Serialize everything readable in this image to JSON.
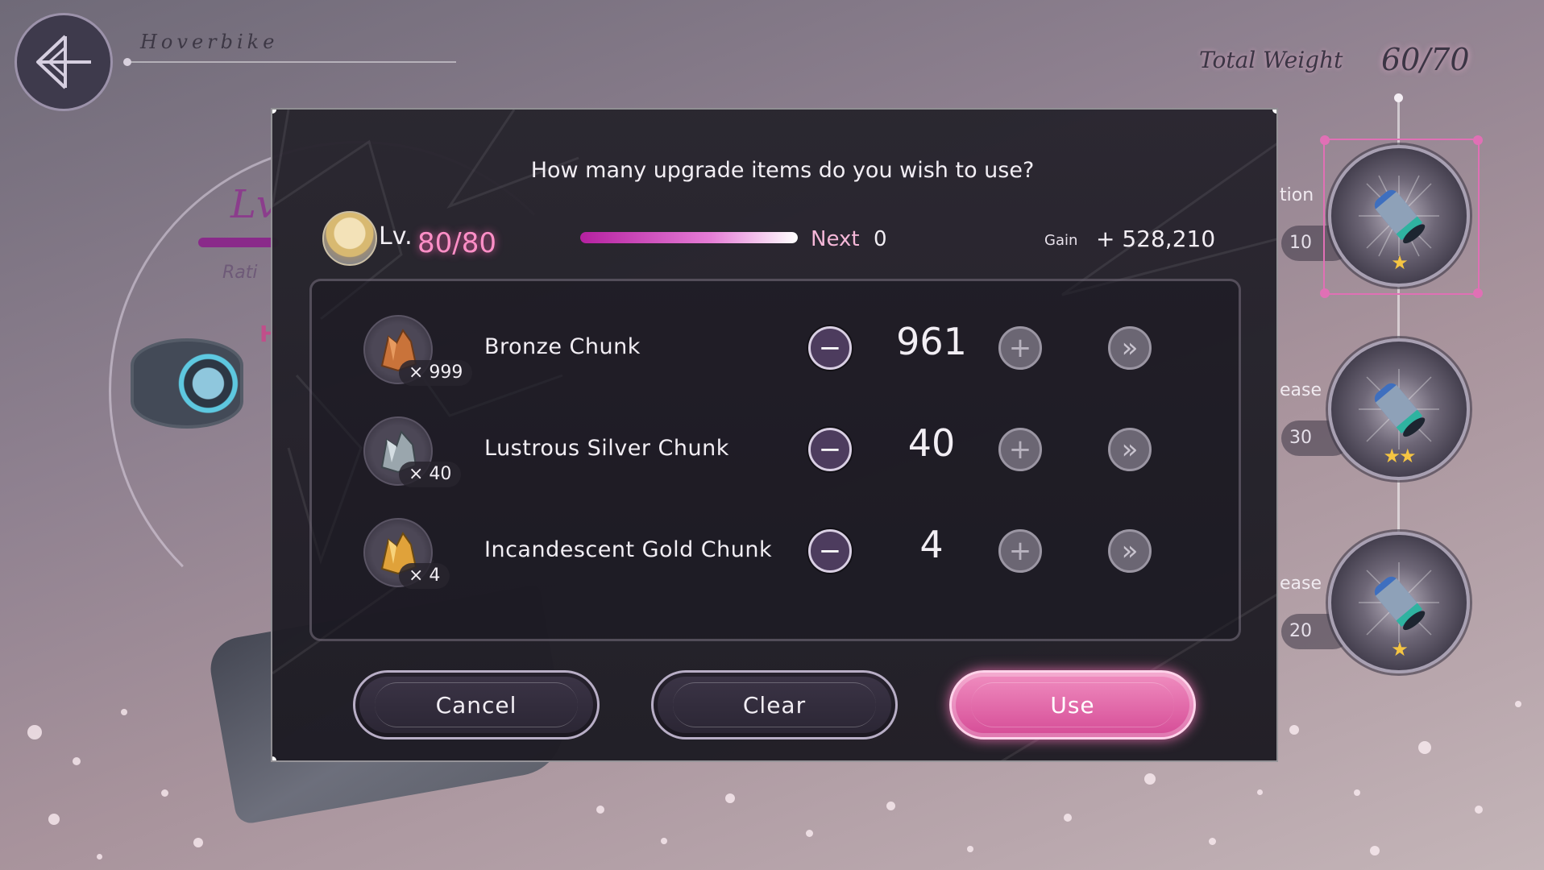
{
  "header": {
    "title": "Hoverbike",
    "back_icon": "back-arrow-icon"
  },
  "weight": {
    "label": "Total Weight",
    "value": "60/70"
  },
  "background": {
    "lv_text": "Lv",
    "rating_text": "Rati",
    "h_text": "H"
  },
  "skill_tree": {
    "nodes": [
      {
        "label": "tion",
        "value": "10",
        "stars": "★",
        "icon": "battery-cell-icon"
      },
      {
        "label": "ease",
        "value": "30",
        "stars": "★★",
        "icon": "battery-cell-icon"
      },
      {
        "label": "ease",
        "value": "20",
        "stars": "★",
        "icon": "battery-cell-icon"
      }
    ]
  },
  "dialog": {
    "question": "How many upgrade items do you wish to use?",
    "level": {
      "label": "Lv.",
      "value": "80/80",
      "exp_fill": 1.0
    },
    "next": {
      "label": "Next",
      "value": "0"
    },
    "gain": {
      "label": "Gain",
      "value": "+ 528,210"
    },
    "items": [
      {
        "name": "Bronze Chunk",
        "count": "× 999",
        "quantity": "961",
        "color": "#c9733a"
      },
      {
        "name": "Lustrous Silver Chunk",
        "count": "× 40",
        "quantity": "40",
        "color": "#9aa6ad"
      },
      {
        "name": "Incandescent Gold Chunk",
        "count": "× 4",
        "quantity": "4",
        "color": "#e0a23a"
      }
    ],
    "buttons": {
      "cancel": "Cancel",
      "clear": "Clear",
      "use": "Use"
    }
  },
  "colors": {
    "accent_pink": "#ff8fc7",
    "dialog_bg": "#28252e"
  }
}
